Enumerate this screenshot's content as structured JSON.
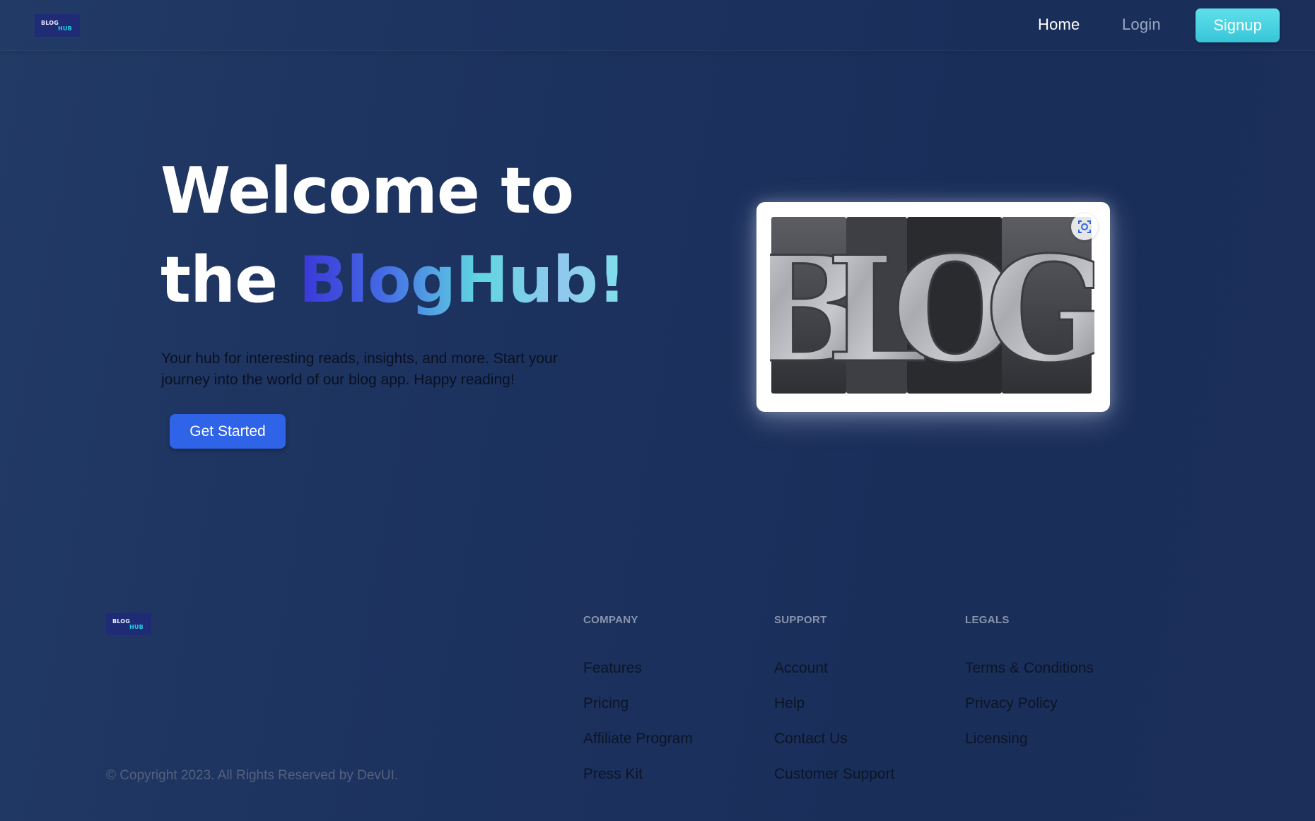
{
  "header": {
    "logo_top": "BLOG",
    "logo_bottom": "HUB",
    "nav": {
      "home": "Home",
      "login": "Login",
      "signup": "Signup"
    }
  },
  "hero": {
    "title_line1": "Welcome to",
    "title_line2_prefix": "the ",
    "title_brand": "BlogHub!",
    "description": "Your hub for interesting reads, insights, and more. Start your journey into the world of our blog app. Happy reading!",
    "cta_label": "Get Started",
    "image_letters": [
      "B",
      "L",
      "O",
      "G"
    ]
  },
  "footer": {
    "logo_top": "BLOG",
    "logo_bottom": "HUB",
    "columns": [
      {
        "heading": "COMPANY",
        "links": [
          "Features",
          "Pricing",
          "Affiliate Program",
          "Press Kit"
        ]
      },
      {
        "heading": "SUPPORT",
        "links": [
          "Account",
          "Help",
          "Contact Us",
          "Customer Support"
        ]
      },
      {
        "heading": "LEGALS",
        "links": [
          "Terms & Conditions",
          "Privacy Policy",
          "Licensing"
        ]
      }
    ],
    "copyright": "© Copyright 2023. All Rights Reserved by DevUI."
  },
  "colors": {
    "background": "#1b2f5a",
    "signup_button": "#45cfdf",
    "cta_button": "#2f63e8",
    "brand_gradient_start": "#3b36d8",
    "brand_gradient_end": "#7fe0e8"
  }
}
